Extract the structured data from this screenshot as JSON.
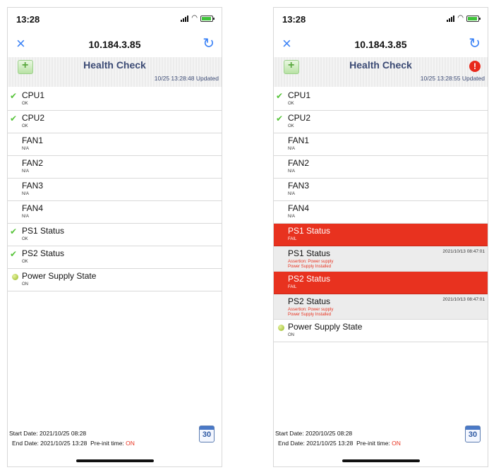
{
  "left": {
    "time": "13:28",
    "host": "10.184.3.85",
    "title": "Health Check",
    "updated": "10/25 13:28:48 Updated",
    "rows": [
      {
        "name": "CPU1",
        "value": "OK"
      },
      {
        "name": "CPU2",
        "value": "OK"
      },
      {
        "name": "FAN1",
        "value": "N/A"
      },
      {
        "name": "FAN2",
        "value": "N/A"
      },
      {
        "name": "FAN3",
        "value": "N/A"
      },
      {
        "name": "FAN4",
        "value": "N/A"
      },
      {
        "name": "PS1 Status",
        "value": "OK"
      },
      {
        "name": "PS2 Status",
        "value": "OK"
      },
      {
        "name": "Power Supply State",
        "value": "ON"
      }
    ],
    "start_date": "Start Date: 2021/10/25 08:28",
    "end_date": "End Date: 2021/10/25 13:28",
    "preinit_label": "Pre-init time:",
    "preinit_value": "ON",
    "calendar_day": "30"
  },
  "right": {
    "time": "13:28",
    "host": "10.184.3.85",
    "title": "Health Check",
    "updated": "10/25 13:28:55 Updated",
    "alert": "!",
    "rows": [
      {
        "name": "CPU1",
        "value": "OK"
      },
      {
        "name": "CPU2",
        "value": "OK"
      },
      {
        "name": "FAN1",
        "value": "N/A"
      },
      {
        "name": "FAN2",
        "value": "N/A"
      },
      {
        "name": "FAN3",
        "value": "N/A"
      },
      {
        "name": "FAN4",
        "value": "N/A"
      },
      {
        "name": "PS1 Status",
        "value": "FAIL"
      },
      {
        "name": "PS1 Status",
        "line1": "Assertion: Power supply",
        "line2": "Power Supply Installed",
        "timestamp": "2021/10/13 08:47:01"
      },
      {
        "name": "PS2 Status",
        "value": "FAIL"
      },
      {
        "name": "PS2 Status",
        "line1": "Assertion: Power supply",
        "line2": "Power Supply Installed",
        "timestamp": "2021/10/13 08:47:01"
      },
      {
        "name": "Power Supply State",
        "value": "ON"
      }
    ],
    "start_date": "Start Date: 2020/10/25 08:28",
    "end_date": "End Date: 2021/10/25 13:28",
    "preinit_label": "Pre-init time:",
    "preinit_value": "ON",
    "calendar_day": "30"
  },
  "colors": {
    "accent": "#3b82f6",
    "fail": "#e8321f",
    "ok": "#57c43a",
    "header_text": "#3b4a74"
  }
}
